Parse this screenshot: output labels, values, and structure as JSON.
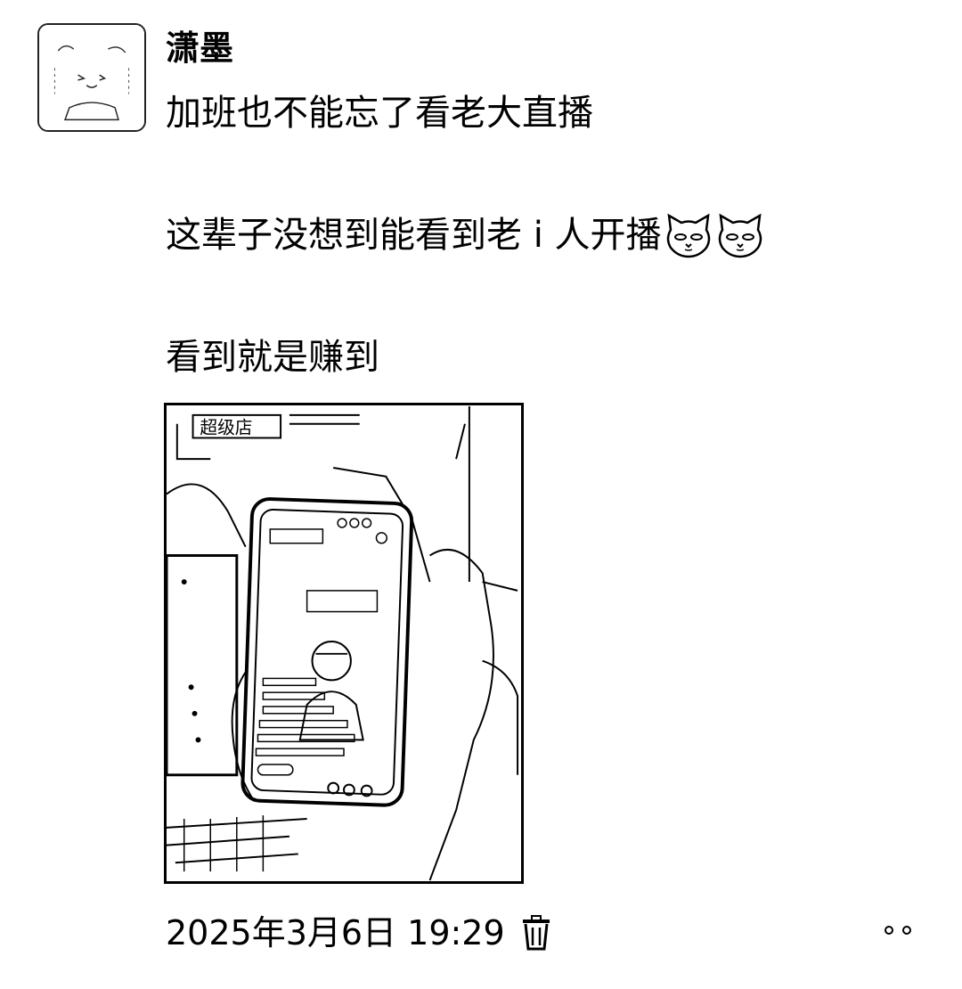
{
  "post": {
    "author": "潇墨",
    "lines": [
      "加班也不能忘了看老大直播",
      "这辈子没想到能看到老 i 人开播",
      "看到就是赚到"
    ],
    "emojis": [
      "cat-face-emoji",
      "cat-face-emoji"
    ],
    "photo_overlay_text": "超级店",
    "timestamp": "2025年3月6日 19:29"
  },
  "icons": {
    "delete": "trash-icon",
    "more": "more-dots-icon"
  }
}
